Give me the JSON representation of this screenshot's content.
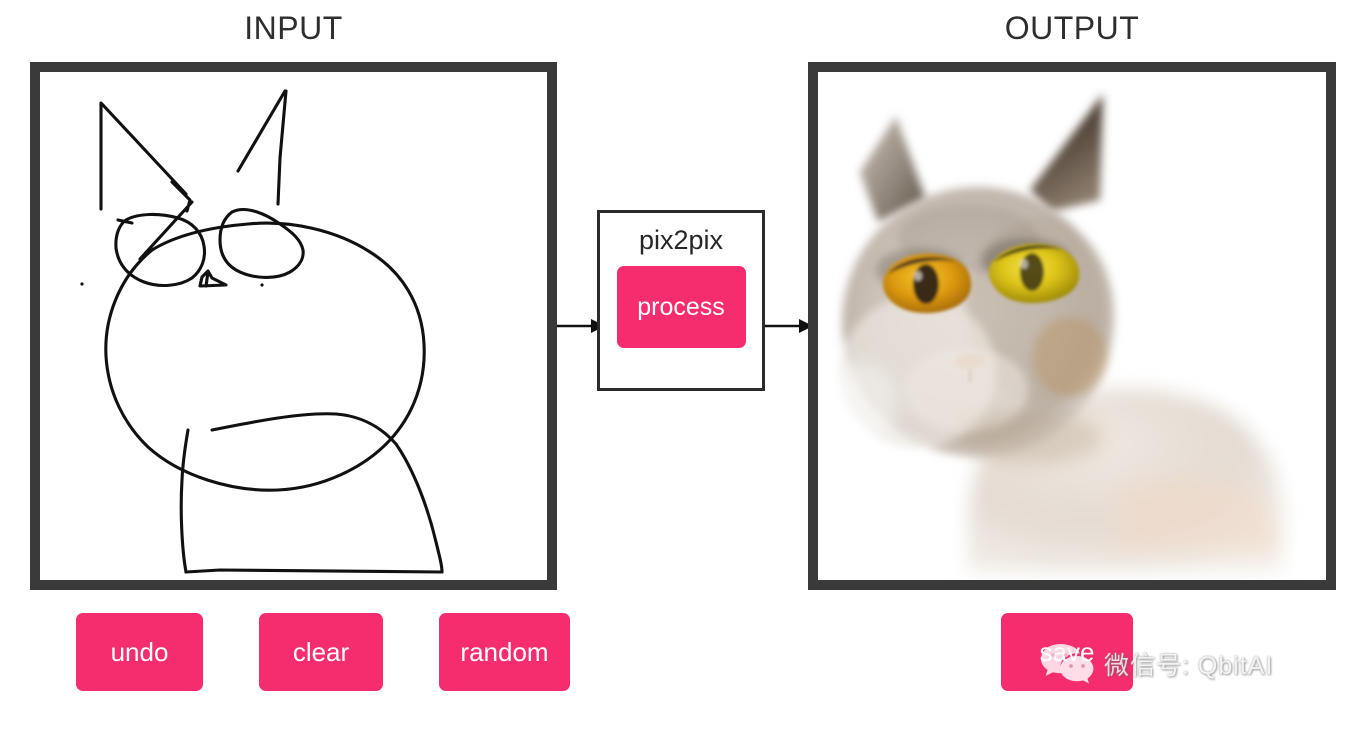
{
  "page": {
    "background_color": "#ffffff",
    "accent_color": "#f52c6e",
    "frame_color": "#3a3a3a"
  },
  "input_panel": {
    "title": "INPUT",
    "canvas_name": "sketch-canvas",
    "drawing_description": "hand-drawn black line sketch of a cat face with two pointed ears, two blob eyes, a small triangular nose, two whisker dots and a body",
    "tools": [
      {
        "label": "undo",
        "name": "undo-button"
      },
      {
        "label": "clear",
        "name": "clear-button"
      },
      {
        "label": "random",
        "name": "random-button"
      }
    ]
  },
  "processor": {
    "title": "pix2pix",
    "process_label": "process",
    "arrow_in_name": "arrow-input-to-processor",
    "arrow_out_name": "arrow-processor-to-output"
  },
  "output_panel": {
    "title": "OUTPUT",
    "image_description": "generated photorealistic cat with grey-beige fur and golden yellow eyes",
    "tools": [
      {
        "label": "save",
        "name": "save-button"
      }
    ]
  },
  "watermark": {
    "text": "微信号: QbitAI",
    "icon": "wechat-icon"
  }
}
